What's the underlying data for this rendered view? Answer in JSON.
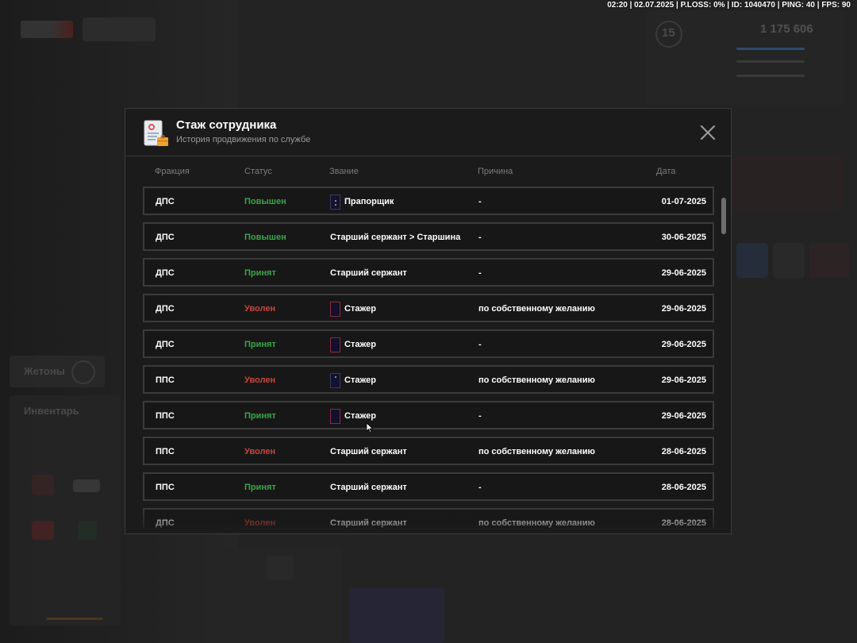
{
  "status_bar": "02:20 | 02.07.2025 | P.LOSS: 0% | ID: 1040470 | PING: 40 | FPS: 90",
  "modal": {
    "title": "Стаж сотрудника",
    "subtitle": "История продвижения по службе",
    "icon": "document-icon",
    "close_icon": "close-icon"
  },
  "columns": [
    "Фракция",
    "Статус",
    "Звание",
    "Причина",
    "Дата"
  ],
  "rows": [
    {
      "faction": "ДПС",
      "status": "Повышен",
      "status_color": "#3aa64a",
      "rank": "Прапорщик",
      "rank_badge": "navy",
      "reason": "-",
      "date": "01-07-2025"
    },
    {
      "faction": "ДПС",
      "status": "Повышен",
      "status_color": "#3aa64a",
      "rank": "Старший сержант > Старшина",
      "rank_badge": "",
      "reason": "-",
      "date": "30-06-2025"
    },
    {
      "faction": "ДПС",
      "status": "Принят",
      "status_color": "#3aa64a",
      "rank": "Старший сержант",
      "rank_badge": "",
      "reason": "-",
      "date": "29-06-2025"
    },
    {
      "faction": "ДПС",
      "status": "Уволен",
      "status_color": "#c9443d",
      "rank": "Стажер",
      "rank_badge": "red",
      "reason": "по собственному желанию",
      "date": "29-06-2025"
    },
    {
      "faction": "ДПС",
      "status": "Принят",
      "status_color": "#3aa64a",
      "rank": "Стажер",
      "rank_badge": "red",
      "reason": "-",
      "date": "29-06-2025"
    },
    {
      "faction": "ППС",
      "status": "Уволен",
      "status_color": "#c9443d",
      "rank": "Стажер",
      "rank_badge": "navy",
      "reason": "по собственному желанию",
      "date": "29-06-2025"
    },
    {
      "faction": "ППС",
      "status": "Принят",
      "status_color": "#3aa64a",
      "rank": "Стажер",
      "rank_badge": "red",
      "reason": "-",
      "date": "29-06-2025"
    },
    {
      "faction": "ППС",
      "status": "Уволен",
      "status_color": "#c9443d",
      "rank": "Старший сержант",
      "rank_badge": "",
      "reason": "по собственному желанию",
      "date": "28-06-2025"
    },
    {
      "faction": "ППС",
      "status": "Принят",
      "status_color": "#3aa64a",
      "rank": "Старший сержант",
      "rank_badge": "",
      "reason": "-",
      "date": "28-06-2025"
    },
    {
      "faction": "ДПС",
      "status": "Уволен",
      "status_color": "#c9443d",
      "rank": "Старший сержант",
      "rank_badge": "",
      "reason": "по собственному желанию",
      "date": "28-06-2025"
    }
  ],
  "background_hud": {
    "money": "1 175 606",
    "level": "15",
    "tokens_label": "Жетоны",
    "inventory_label": "Инвентарь"
  }
}
